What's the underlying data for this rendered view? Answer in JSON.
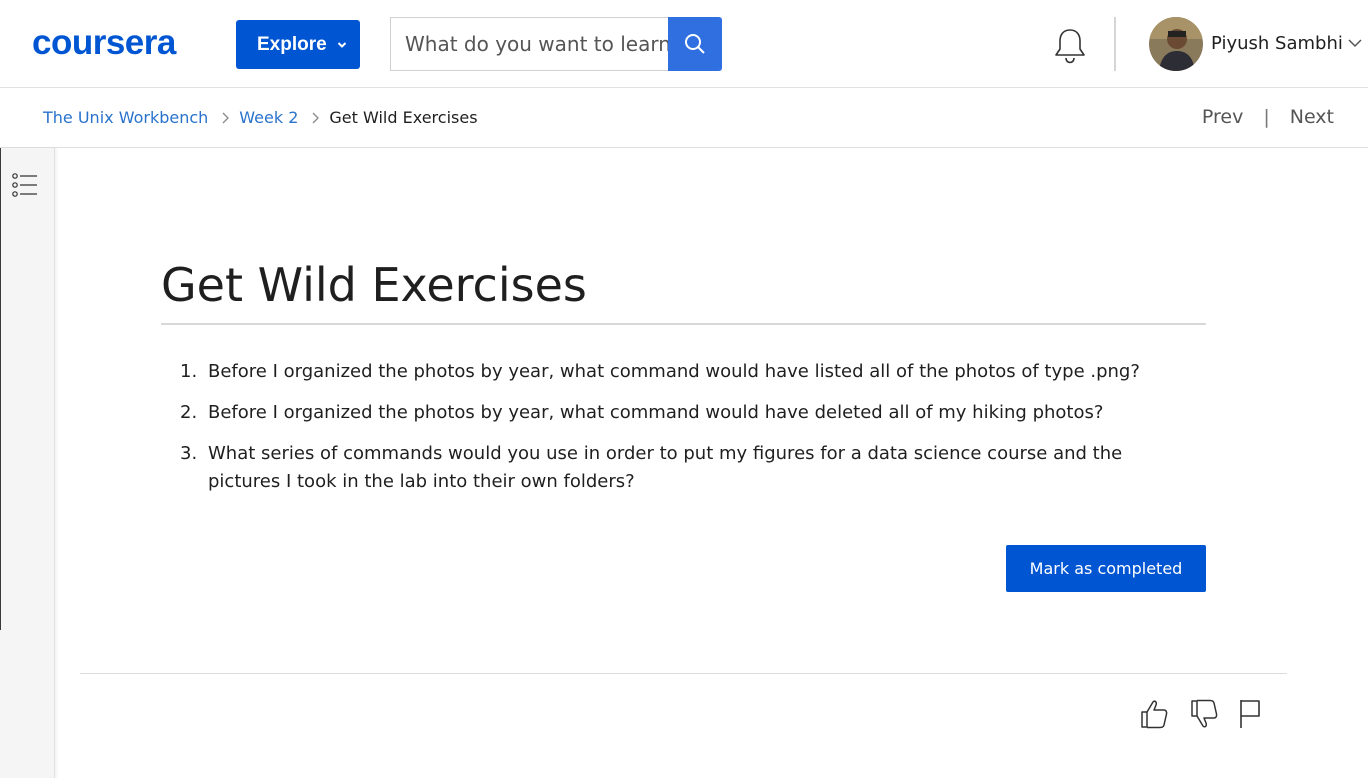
{
  "header": {
    "logo_text": "coursera",
    "explore_label": "Explore",
    "search_placeholder": "What do you want to learn?",
    "user_name": "Piyush Sambhi",
    "brand_color": "#0056d2"
  },
  "breadcrumb": {
    "items": [
      "The Unix Workbench",
      "Week 2",
      "Get Wild Exercises"
    ]
  },
  "nav": {
    "prev_label": "Prev",
    "separator": "|",
    "next_label": "Next"
  },
  "content": {
    "title": "Get Wild Exercises",
    "exercises": [
      {
        "number": "1.",
        "text": "Before I organized the photos by year, what command would have listed all of the photos of type .png?"
      },
      {
        "number": "2.",
        "text": "Before I organized the photos by year, what command would have deleted all of my hiking photos?"
      },
      {
        "number": "3.",
        "text": "What series of commands would you use in order to put my figures for a data science course and the pictures I took in the lab into their own folders?"
      }
    ],
    "mark_completed_label": "Mark as completed"
  },
  "icons": [
    "chevron-down-icon",
    "search-icon",
    "bell-icon",
    "chevron-right-icon",
    "table-of-contents-icon",
    "thumbs-up-icon",
    "thumbs-down-icon",
    "flag-icon"
  ]
}
